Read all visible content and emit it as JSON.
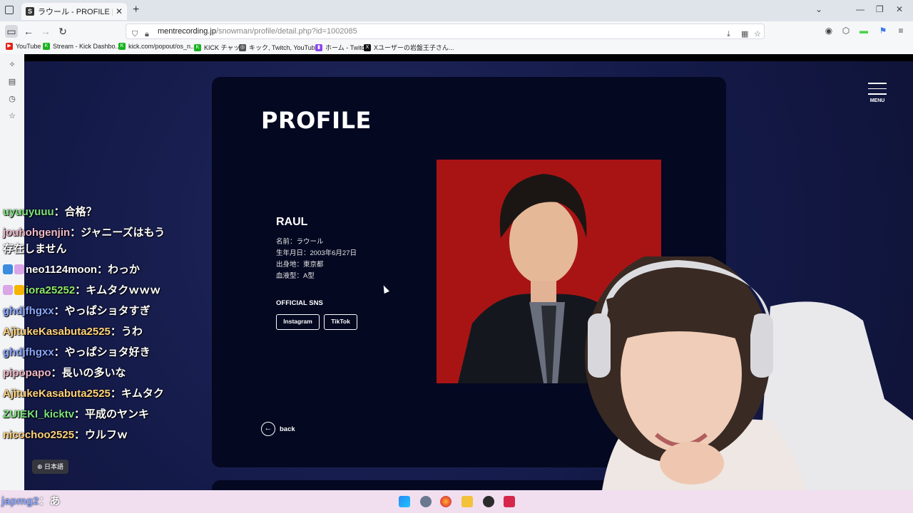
{
  "browser": {
    "tab_title": "ラウール - PROFILE | Snow Man",
    "tab_favicon": "S",
    "new_tab_symbol": "+",
    "url_host": "mentrecording.jp",
    "url_path": "/snowman/profile/detail.php?id=1002085",
    "bookmarks": [
      {
        "label": "YouTube",
        "color": "#e62117",
        "glyph": "▶"
      },
      {
        "label": "Stream - Kick Dashbo...",
        "color": "#19b31f",
        "glyph": "K"
      },
      {
        "label": "kick.com/popout/os_n...",
        "color": "#19b31f",
        "glyph": "K"
      },
      {
        "label": "KICK チャット",
        "color": "#19b31f",
        "glyph": "K"
      },
      {
        "label": "キック, Twitch, YouTub...",
        "color": "#555555",
        "glyph": "◎"
      },
      {
        "label": "ホーム - Twitch",
        "color": "#8a46ee",
        "glyph": "▮"
      },
      {
        "label": "Xユーザーの岩盤王子さん...",
        "color": "#111111",
        "glyph": "X"
      }
    ]
  },
  "page": {
    "title": "PROFILE",
    "name": "RAUL",
    "info": [
      "名前：ラウール",
      "生年月日：2003年6月27日",
      "出身地：東京都",
      "血液型：A型"
    ],
    "sns_heading": "OFFICIAL SNS",
    "sns_buttons": [
      "Instagram",
      "TikTok"
    ],
    "back_label": "back",
    "back_symbol": "←",
    "menu_label": "MENU"
  },
  "chat": {
    "messages": [
      {
        "user": "uyuuyuuu",
        "color": "#7be37b",
        "text": "：合格？",
        "wrap": false
      },
      {
        "user": "jouhohgenjin",
        "color": "#f0b8c8",
        "text": "：ジャニーズはもう存在しません",
        "wrap": true
      },
      {
        "user": "neo1124moon",
        "color": "#ffffff",
        "text": "：わっか",
        "wrap": false,
        "badges": [
          "#3b8be0",
          "#d9a6e8"
        ]
      },
      {
        "user": "iora25252",
        "color": "#8ee86b",
        "text": "：キムタクｗｗｗ",
        "wrap": true,
        "badges": [
          "#d9a6e8",
          "#f5b400"
        ]
      },
      {
        "user": "ghdjfhgxx",
        "color": "#8aa6ff",
        "text": "：やっぱショタすぎ",
        "wrap": false
      },
      {
        "user": "AjitukeKasabuta2525",
        "color": "#ffd27a",
        "text": "：うわ",
        "wrap": false
      },
      {
        "user": "ghdjfhgxx",
        "color": "#8aa6ff",
        "text": "：やっぱショタ好き",
        "wrap": false
      },
      {
        "user": "pipopapo",
        "color": "#f0b8c8",
        "text": "：長いの多いな",
        "wrap": false
      },
      {
        "user": "AjitukeKasabuta2525",
        "color": "#ffd27a",
        "text": "：キムタク",
        "wrap": true
      },
      {
        "user": "ZUIEKI_kicktv",
        "color": "#7be37b",
        "text": "：平成のヤンキ",
        "wrap": false
      },
      {
        "user": "nicochoo2525",
        "color": "#ffd27a",
        "text": "：ウルフｗ",
        "wrap": false
      }
    ],
    "bottom_message": {
      "user": "japmg2",
      "color": "#8aa6ff",
      "text": "：あ"
    },
    "lang_button": "日本語"
  },
  "colors": {
    "page_bg": "#141a48",
    "card_bg": "#040821",
    "photo_bg": "#a81414",
    "taskbar_bg": "#f1dff0"
  }
}
